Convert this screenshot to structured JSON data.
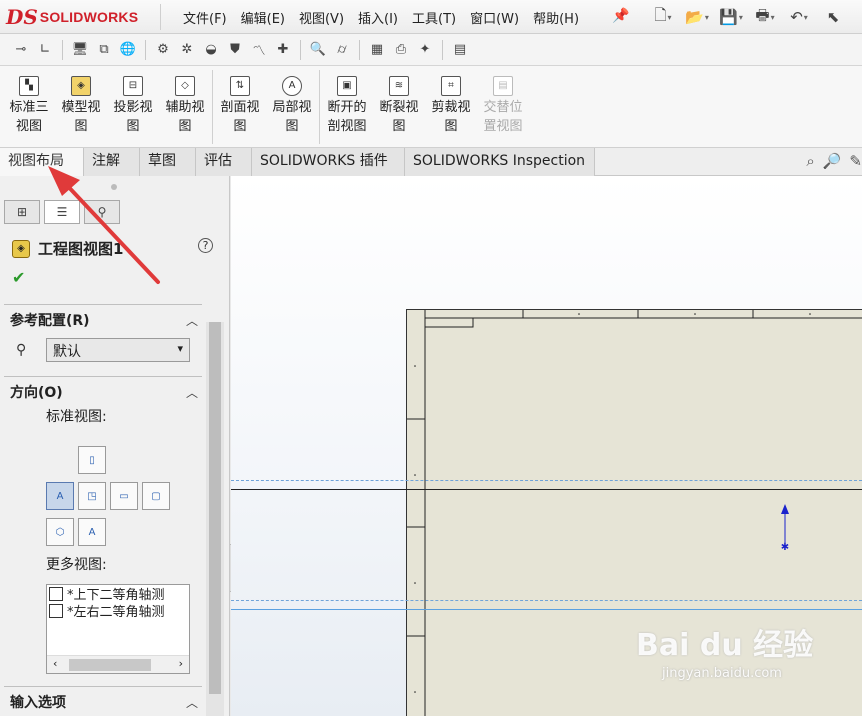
{
  "app": {
    "logo_ds": "DS",
    "logo_text": "SOLIDWORKS"
  },
  "menu": [
    "文件(F)",
    "编辑(E)",
    "视图(V)",
    "插入(I)",
    "工具(T)",
    "窗口(W)",
    "帮助(H)"
  ],
  "ribbon": [
    {
      "l1": "标准三",
      "l2": "视图",
      "disabled": false
    },
    {
      "l1": "模型视",
      "l2": "图",
      "disabled": false
    },
    {
      "l1": "投影视",
      "l2": "图",
      "disabled": false
    },
    {
      "l1": "辅助视",
      "l2": "图",
      "disabled": false
    },
    {
      "l1": "剖面视",
      "l2": "图",
      "disabled": false
    },
    {
      "l1": "局部视",
      "l2": "图",
      "disabled": false
    },
    {
      "l1": "断开的",
      "l2": "剖视图",
      "disabled": false
    },
    {
      "l1": "断裂视",
      "l2": "图",
      "disabled": false
    },
    {
      "l1": "剪裁视",
      "l2": "图",
      "disabled": false
    },
    {
      "l1": "交替位",
      "l2": "置视图",
      "disabled": true
    }
  ],
  "tabs": [
    "视图布局",
    "注解",
    "草图",
    "评估",
    "SOLIDWORKS 插件",
    "SOLIDWORKS Inspection"
  ],
  "panel": {
    "title": "工程图视图1",
    "help": "?",
    "check": "✔",
    "ref_config_label": "参考配置(R)",
    "config_value": "默认",
    "orientation_label": "方向(O)",
    "standard_views_label": "标准视图:",
    "more_views_label": "更多视图:",
    "more_views": [
      "*上下二等角轴测",
      "*左右二等角轴测"
    ],
    "input_options_label": "输入选项"
  },
  "watermark": {
    "text": "Bai du 经验",
    "url": "jingyan.baidu.com"
  }
}
